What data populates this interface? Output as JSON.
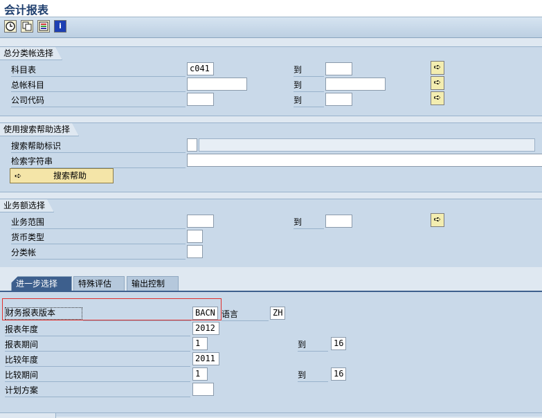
{
  "window": {
    "title": "会计报表"
  },
  "toolbar": {
    "icons": [
      "execute-icon",
      "variant-icon",
      "dynamic-select-icon",
      "info-icon"
    ]
  },
  "group1": {
    "title": "总分类帐选择",
    "chart_of_accounts": {
      "label": "科目表",
      "value": "c041",
      "to_label": "到",
      "to_value": ""
    },
    "gl_account": {
      "label": "总帐科目",
      "value": "",
      "to_label": "到",
      "to_value": ""
    },
    "company_code": {
      "label": "公司代码",
      "value": "",
      "to_label": "到",
      "to_value": ""
    }
  },
  "group2": {
    "title": "使用搜索帮助选择",
    "search_help_id": {
      "label": "搜索帮助标识",
      "value": ""
    },
    "search_string": {
      "label": "检索字符串",
      "value": ""
    },
    "search_help_button": "搜索帮助"
  },
  "group3": {
    "title": "业务额选择",
    "business_area": {
      "label": "业务范围",
      "value": "",
      "to_label": "到",
      "to_value": ""
    },
    "currency_type": {
      "label": "货币类型",
      "value": ""
    },
    "ledger": {
      "label": "分类帐",
      "value": ""
    }
  },
  "tabs": [
    {
      "label": "进一步选择",
      "active": true
    },
    {
      "label": "特殊评估",
      "active": false
    },
    {
      "label": "输出控制",
      "active": false
    }
  ],
  "further": {
    "fs_version": {
      "label": "财务报表版本",
      "value": "BACN",
      "lang_label": "语言",
      "lang_value": "ZH"
    },
    "reporting_year": {
      "label": "报表年度",
      "value": "2012"
    },
    "reporting_periods": {
      "label": "报表期间",
      "from": "1",
      "to_label": "到",
      "to": "16"
    },
    "comparison_year": {
      "label": "比较年度",
      "value": "2011"
    },
    "comparison_periods": {
      "label": "比较期间",
      "from": "1",
      "to_label": "到",
      "to": "16"
    },
    "plan_version": {
      "label": "计划方案",
      "value": ""
    }
  },
  "colors": {
    "highlight_border": "#e0302c",
    "active_tab": "#3d5f8d",
    "group_bg": "#c9d9e9"
  }
}
